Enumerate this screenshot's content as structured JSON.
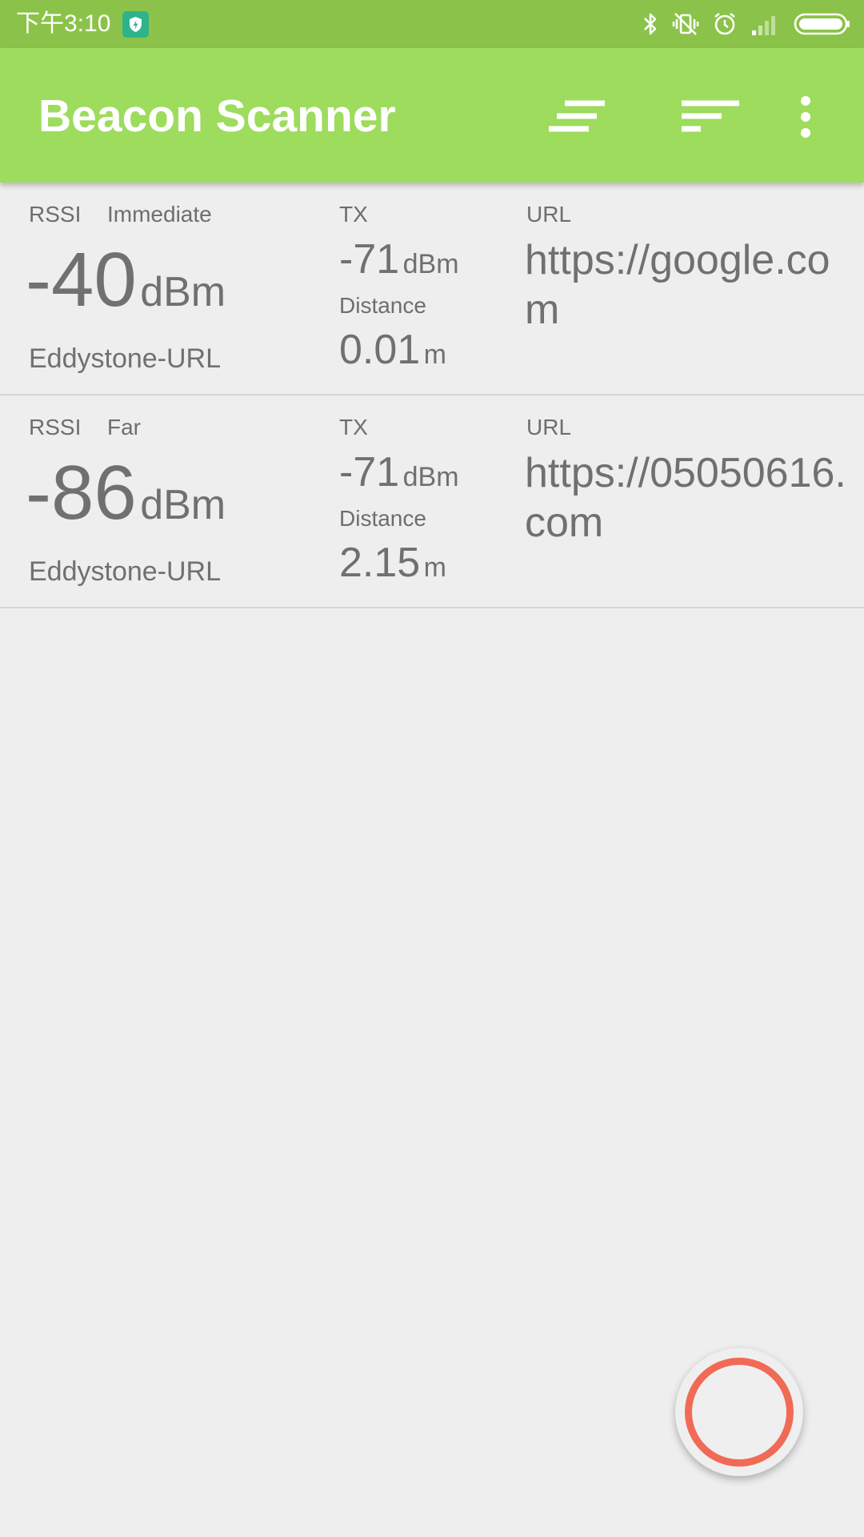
{
  "status_bar": {
    "time": "下午3:10",
    "icons": [
      "shield-icon",
      "bluetooth-icon",
      "vibrate-off-icon",
      "alarm-icon",
      "signal-icon",
      "battery-icon"
    ]
  },
  "app_bar": {
    "title": "Beacon Scanner",
    "actions": [
      "sort-lines-icon",
      "filter-sort-icon",
      "more-vert-icon"
    ],
    "color": "#9ddc5d"
  },
  "beacons": [
    {
      "rssi_label": "RSSI",
      "proximity": "Immediate",
      "rssi_value": "-40",
      "rssi_unit": "dBm",
      "type": "Eddystone-URL",
      "tx_label": "TX",
      "tx_value": "-71",
      "tx_unit": "dBm",
      "distance_label": "Distance",
      "distance_value": "0.01",
      "distance_unit": "m",
      "url_label": "URL",
      "url": "https://google.com"
    },
    {
      "rssi_label": "RSSI",
      "proximity": "Far",
      "rssi_value": "-86",
      "rssi_unit": "dBm",
      "type": "Eddystone-URL",
      "tx_label": "TX",
      "tx_value": "-71",
      "tx_unit": "dBm",
      "distance_label": "Distance",
      "distance_value": "2.15",
      "distance_unit": "m",
      "url_label": "URL",
      "url": "https://05050616.com"
    }
  ],
  "fab": {
    "icon": "scan-ring-icon",
    "ring_color": "#f06a55"
  }
}
